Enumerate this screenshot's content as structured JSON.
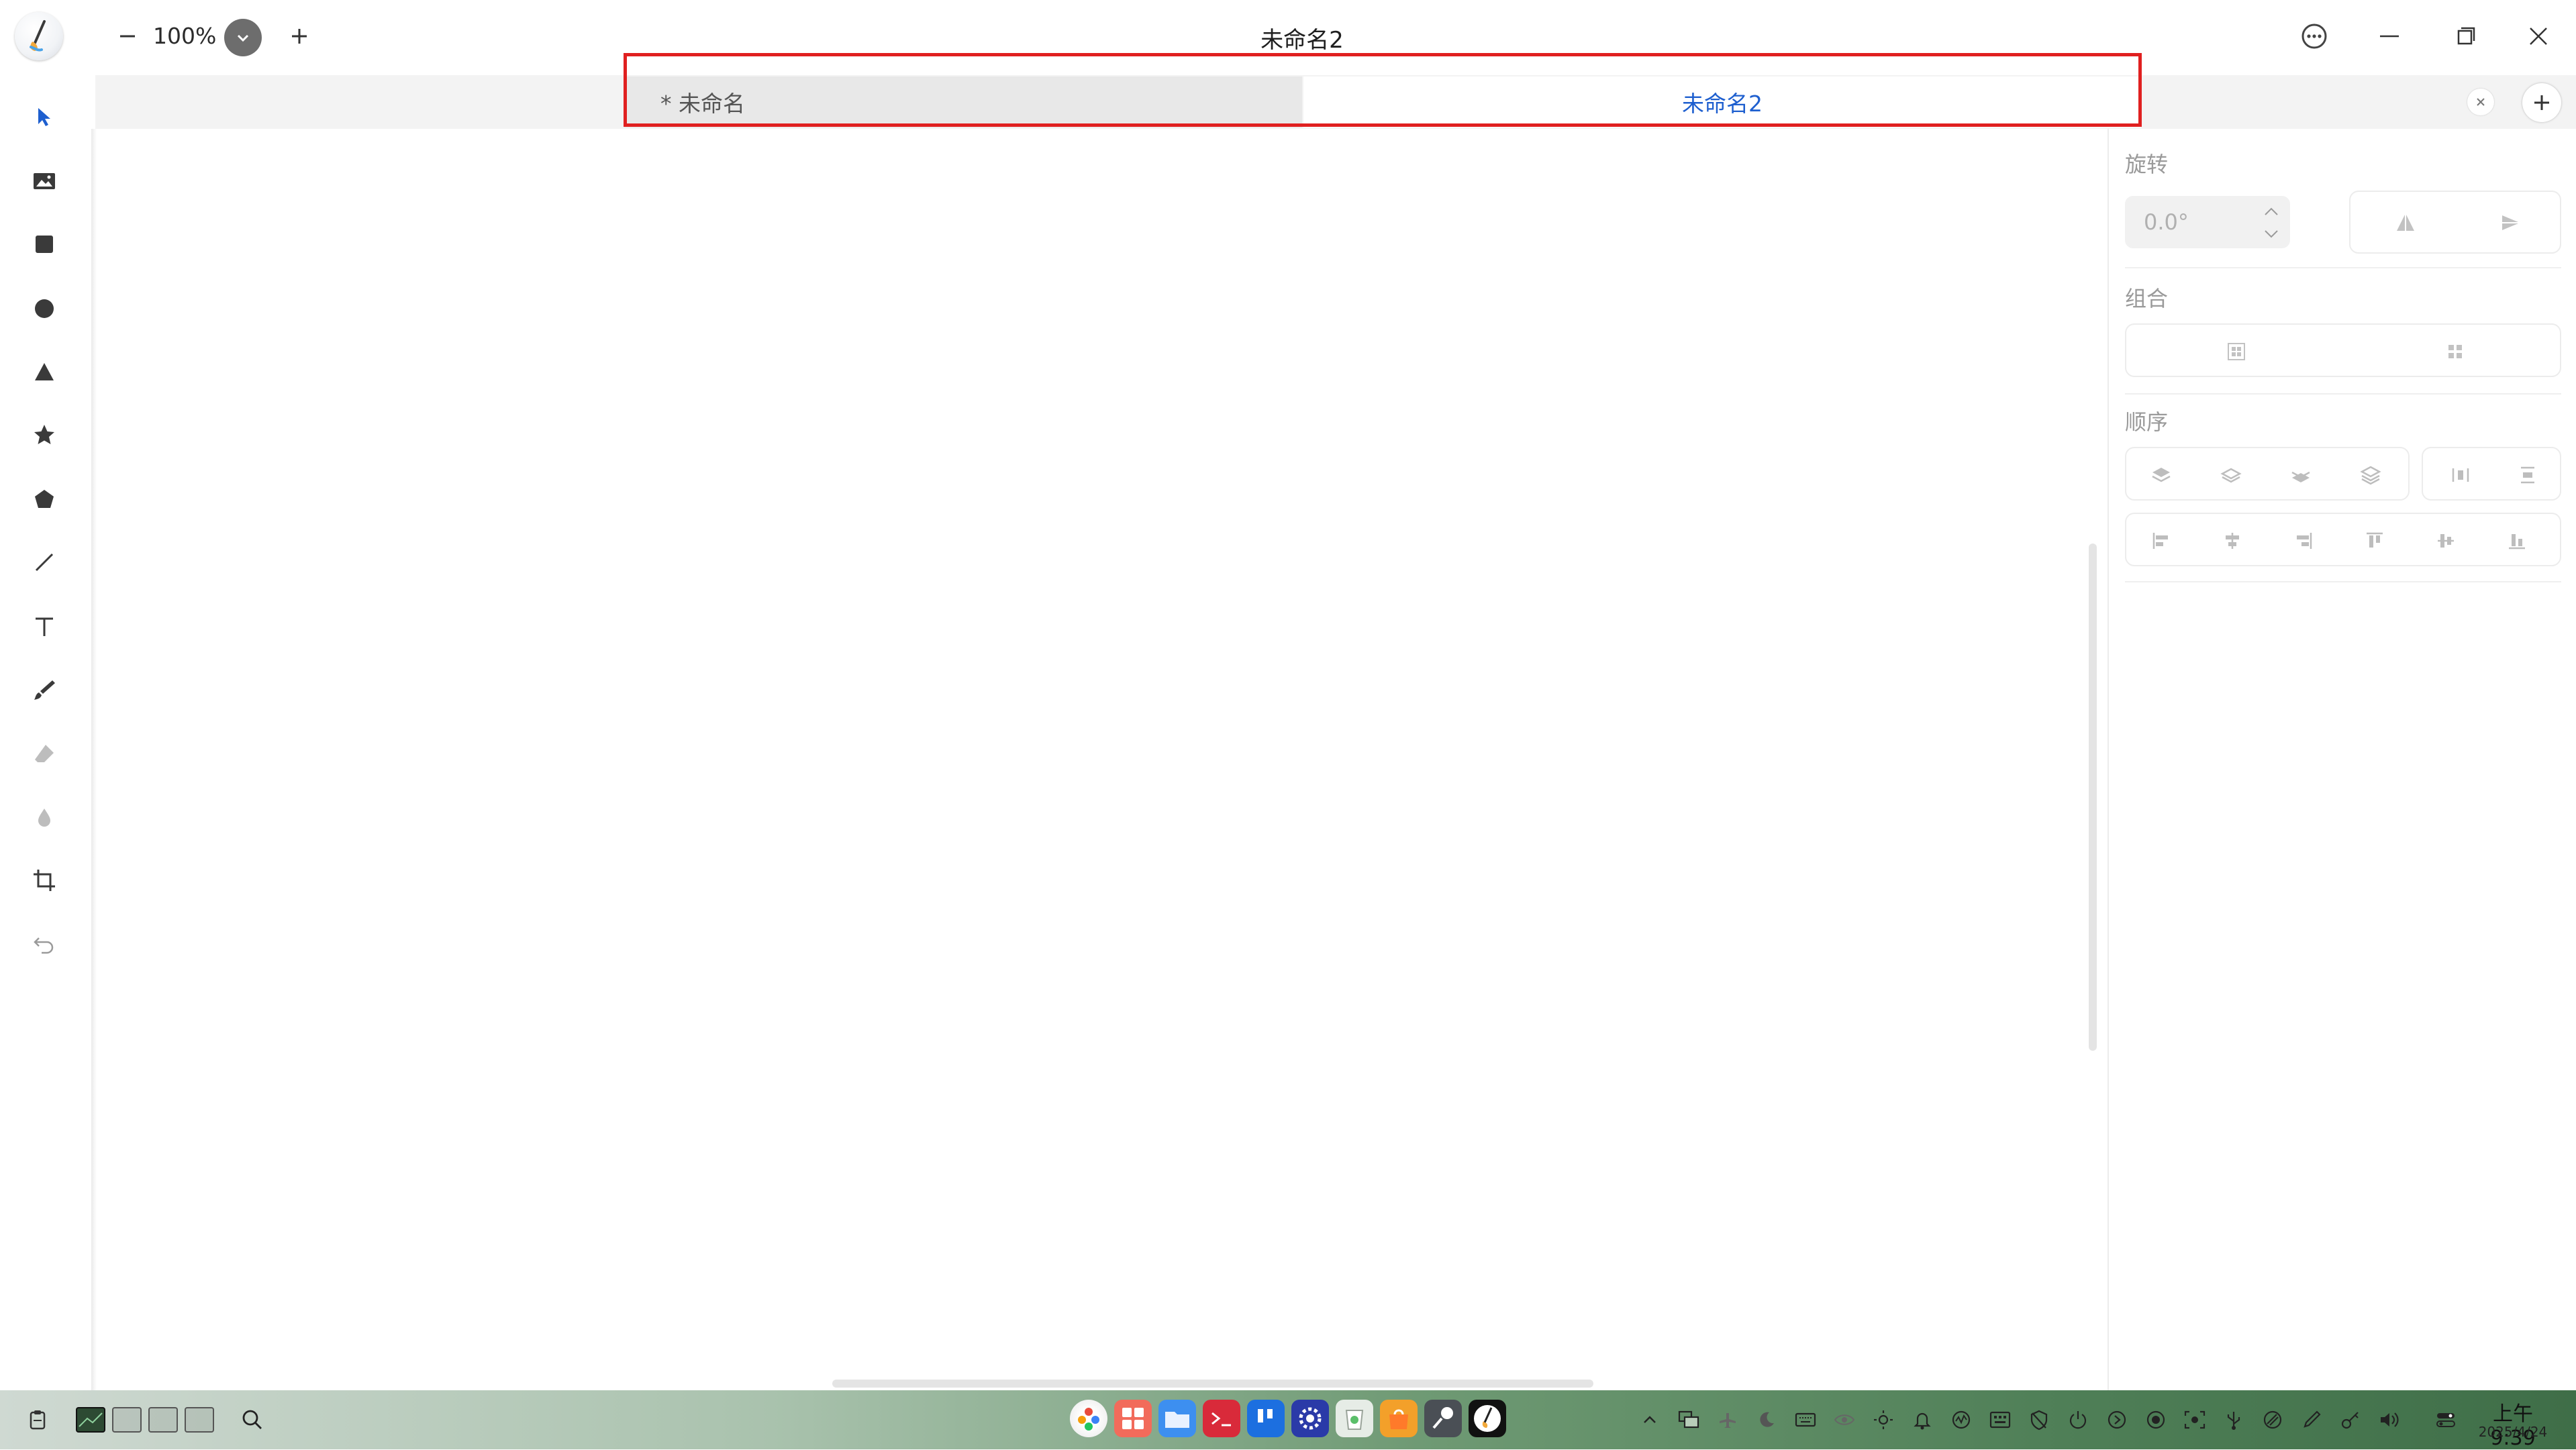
{
  "title_bar": {
    "zoom_value": "100%",
    "window_title": "未命名2"
  },
  "tabs": [
    {
      "label": "* 未命名",
      "active": false
    },
    {
      "label": "未命名2",
      "active": true
    }
  ],
  "left_toolbar": {
    "tools": [
      "select-arrow-icon",
      "image-icon",
      "rectangle-icon",
      "ellipse-icon",
      "triangle-icon",
      "star-icon",
      "polygon-icon",
      "line-icon",
      "text-icon",
      "brush-icon",
      "eraser-icon",
      "blur-icon",
      "crop-icon",
      "undo-icon"
    ]
  },
  "right_panel": {
    "rotation_title": "旋转",
    "rotation_value": "0.0°",
    "group_title": "组合",
    "order_title": "顺序"
  },
  "taskbar": {
    "time": "上午9:39",
    "date": "2025/4/24"
  },
  "colors": {
    "accent": "#1e5fcf",
    "highlight_box": "#e02020",
    "taskbar_gradient_end": "#3f6e48"
  }
}
